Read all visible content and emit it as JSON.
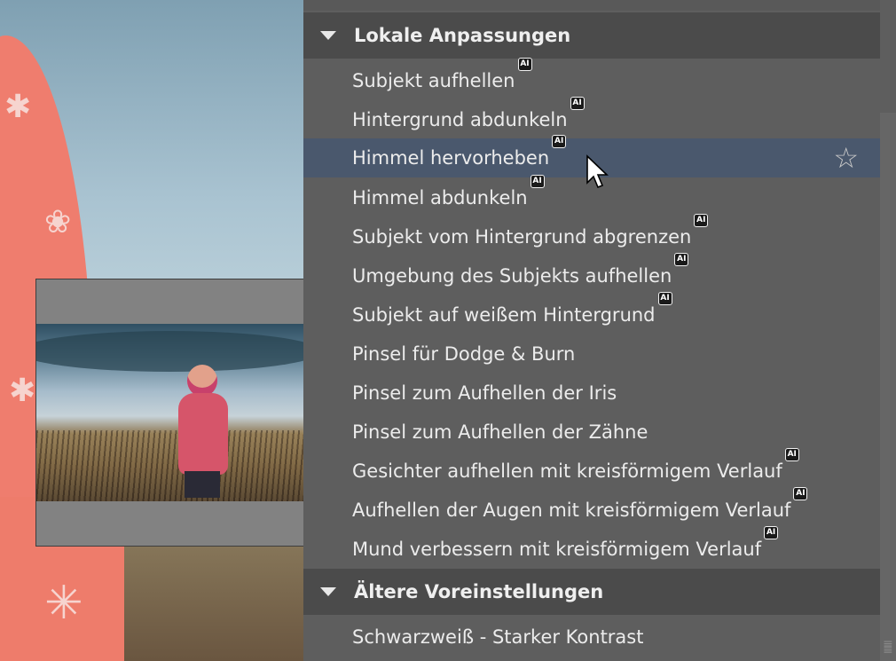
{
  "sections": [
    {
      "title": "Lokale Anpassungen",
      "items": [
        {
          "label": "Subjekt aufhellen",
          "ai": true
        },
        {
          "label": "Hintergrund abdunkeln",
          "ai": true
        },
        {
          "label": "Himmel hervorheben",
          "ai": true,
          "highlighted": true,
          "favorite_icon": "star-outline-icon"
        },
        {
          "label": "Himmel abdunkeln",
          "ai": true
        },
        {
          "label": "Subjekt vom Hintergrund abgrenzen",
          "ai": true
        },
        {
          "label": "Umgebung des Subjekts aufhellen",
          "ai": true
        },
        {
          "label": "Subjekt auf weißem Hintergrund",
          "ai": true
        },
        {
          "label": "Pinsel für Dodge & Burn",
          "ai": false
        },
        {
          "label": "Pinsel zum Aufhellen der Iris",
          "ai": false
        },
        {
          "label": "Pinsel zum Aufhellen der Zähne",
          "ai": false
        },
        {
          "label": "Gesichter aufhellen mit kreisförmigem Verlauf",
          "ai": true
        },
        {
          "label": "Aufhellen der Augen mit kreisförmigem Verlauf",
          "ai": true
        },
        {
          "label": "Mund verbessern mit kreisförmigem Verlauf",
          "ai": true
        }
      ]
    },
    {
      "title": "Ältere Voreinstellungen",
      "items": [
        {
          "label": "Schwarzweiß - Starker Kontrast",
          "ai": false
        }
      ]
    }
  ],
  "ai_badge_text": "AI",
  "colors": {
    "panel_bg": "#5e5e5e",
    "header_bg": "#4b4b4b",
    "highlight_bg": "#4a586d",
    "text": "#ececec"
  }
}
